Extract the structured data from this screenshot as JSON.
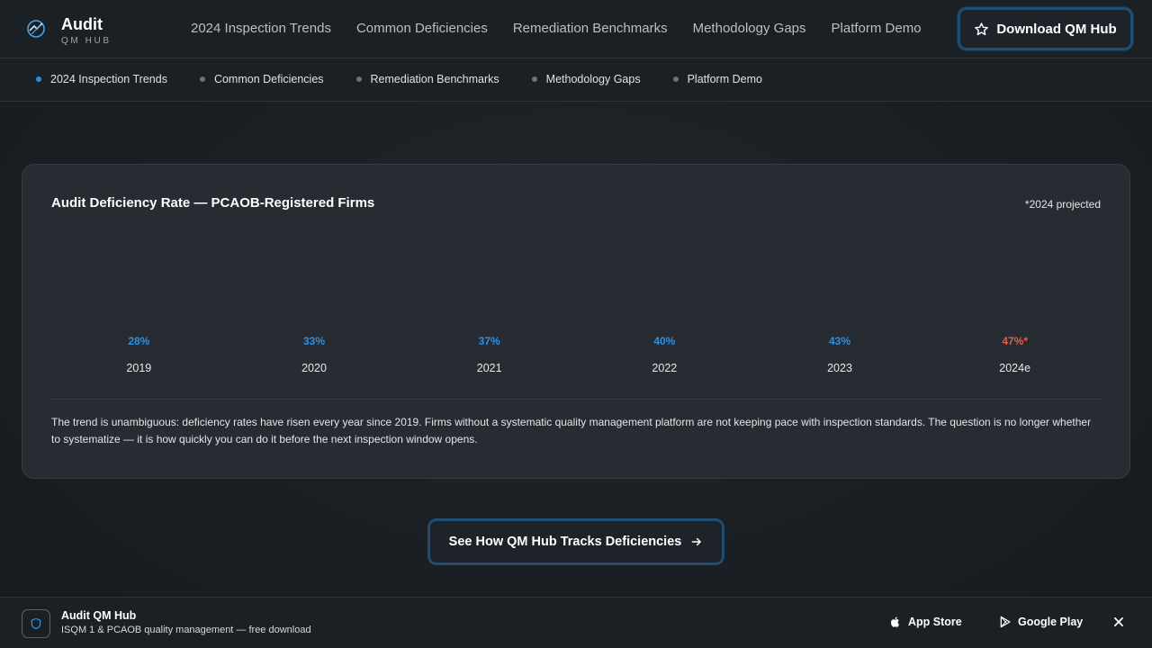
{
  "header": {
    "brand_title": "Audit",
    "brand_subtitle": "QM HUB",
    "nav": [
      {
        "label": "2024 Inspection Trends"
      },
      {
        "label": "Common Deficiencies"
      },
      {
        "label": "Remediation Benchmarks"
      },
      {
        "label": "Methodology Gaps"
      },
      {
        "label": "Platform Demo"
      }
    ],
    "download_label": "Download QM Hub",
    "download_icon": "star-icon"
  },
  "subnav": {
    "active_index": 0,
    "items": [
      {
        "label": "2024 Inspection Trends"
      },
      {
        "label": "Common Deficiencies"
      },
      {
        "label": "Remediation Benchmarks"
      },
      {
        "label": "Methodology Gaps"
      },
      {
        "label": "Platform Demo"
      }
    ]
  },
  "card": {
    "title": "Audit Deficiency Rate — PCAOB-Registered Firms",
    "note": "*2024 projected",
    "body": "The trend is unambiguous: deficiency rates have risen every year since 2019. Firms without a systematic quality management platform are not keeping pace with inspection standards. The question is no longer whether to systematize — it is how quickly you can do it before the next inspection window opens."
  },
  "chart_data": {
    "type": "bar",
    "title": "Audit Deficiency Rate — PCAOB-Registered Firms",
    "categories": [
      "2019",
      "2020",
      "2021",
      "2022",
      "2023",
      "2024e"
    ],
    "values": [
      28,
      33,
      37,
      40,
      43,
      47
    ],
    "data_labels": [
      "28%",
      "33%",
      "37%",
      "40%",
      "43%",
      "47%*"
    ],
    "projected": [
      false,
      false,
      false,
      false,
      false,
      true
    ],
    "colors": {
      "actual": "#2f8fe0",
      "projected": "#e0604a"
    }
  },
  "cta": {
    "label": "See How QM Hub Tracks Deficiencies",
    "icon": "arrow-right-icon"
  },
  "app_banner": {
    "name": "Audit QM Hub",
    "tagline": "ISQM 1 & PCAOB quality management — free download",
    "icon": "shield-icon",
    "app_store_label": "App Store",
    "google_play_label": "Google Play"
  },
  "colors": {
    "accent": "#2b8fe0",
    "projected": "#e0604a",
    "background": "#1b2024"
  }
}
